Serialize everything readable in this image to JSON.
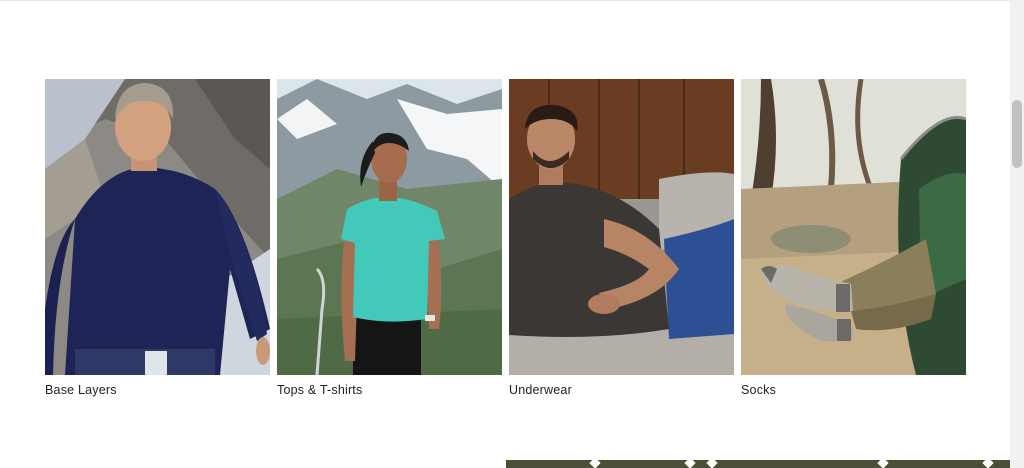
{
  "categories": [
    {
      "label": "Base Layers",
      "image": "man-navy-long-sleeve-mountains"
    },
    {
      "label": "Tops & T-shirts",
      "image": "woman-teal-tee-snowy-peaks"
    },
    {
      "label": "Underwear",
      "image": "man-grey-tee-on-couch"
    },
    {
      "label": "Socks",
      "image": "hiking-socks-feet-from-tent"
    }
  ],
  "colors": {
    "banner": "#4b4f35",
    "scrollbar_track": "#f1f1f1",
    "scrollbar_thumb": "#c1c1c1"
  }
}
